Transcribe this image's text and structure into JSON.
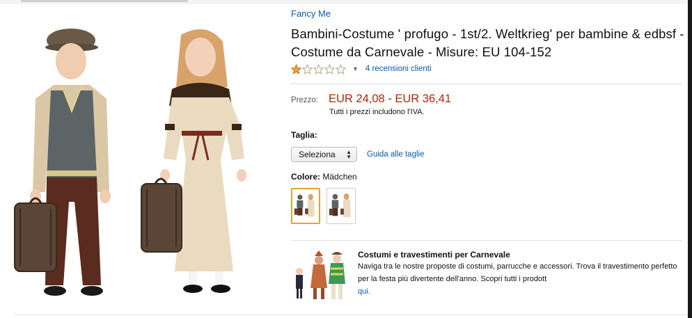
{
  "brand": "Fancy Me",
  "title": "Bambini-Costume ' profugo - 1st/2. Weltkrieg' per bambine & edbsf - Costume da Carnevale - Misure: EU 104-152",
  "rating": {
    "stars": 1,
    "max": 5,
    "reviews_link": "4 recensioni clienti"
  },
  "price": {
    "label": "Prezzo:",
    "value": "EUR 24,08 - EUR 36,41",
    "vat_note": "Tutti i prezzi includono l'IVA."
  },
  "size": {
    "label": "Taglia:",
    "selected": "Seleziona",
    "guide_link": "Guida alle taglie"
  },
  "color": {
    "label": "Colore:",
    "value": "Mädchen",
    "swatch_count": 2,
    "selected_index": 0
  },
  "promo": {
    "title": "Costumi e travestimenti per Carnevale",
    "body": "Naviga tra le nostre proposte di costumi, parrucche e accessori. Trova il travestimento perfetto per la festa più divertente dell'anno. Scopri tutti i prodott",
    "link": "qui."
  },
  "colors": {
    "link": "#0a58a8",
    "price": "#b12704",
    "star": "#e8a33a",
    "selected_swatch": "#e3a32f"
  },
  "icons": [
    "star-icon",
    "chevron-down-icon",
    "select-arrows-icon"
  ]
}
